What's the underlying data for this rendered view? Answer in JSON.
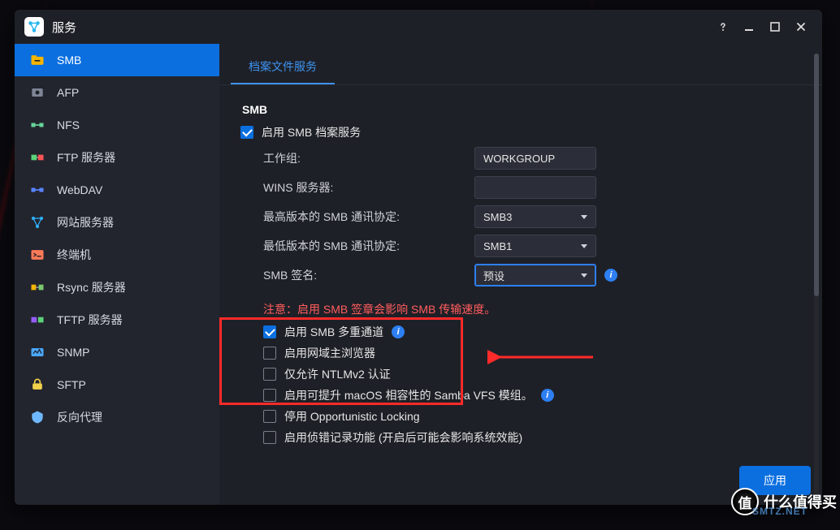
{
  "titlebar": {
    "title": "服务"
  },
  "sidebar": {
    "items": [
      {
        "id": "smb",
        "label": "SMB",
        "icon": "share-folder-icon",
        "color": "#f4b400"
      },
      {
        "id": "afp",
        "label": "AFP",
        "icon": "afp-icon",
        "color": "#7e8596"
      },
      {
        "id": "nfs",
        "label": "NFS",
        "icon": "nfs-icon",
        "color": "#66d59a"
      },
      {
        "id": "ftp",
        "label": "FTP 服务器",
        "icon": "ftp-icon",
        "color": "#5bd37a"
      },
      {
        "id": "webdav",
        "label": "WebDAV",
        "icon": "webdav-icon",
        "color": "#5884ff"
      },
      {
        "id": "website",
        "label": "网站服务器",
        "icon": "website-icon",
        "color": "#2fb0ff"
      },
      {
        "id": "terminal",
        "label": "终端机",
        "icon": "terminal-icon",
        "color": "#ff7a59"
      },
      {
        "id": "rsync",
        "label": "Rsync 服务器",
        "icon": "rsync-icon",
        "color": "#7bc96f"
      },
      {
        "id": "tftp",
        "label": "TFTP 服务器",
        "icon": "tftp-icon",
        "color": "#945eff"
      },
      {
        "id": "snmp",
        "label": "SNMP",
        "icon": "snmp-icon",
        "color": "#4aa8ff"
      },
      {
        "id": "sftp",
        "label": "SFTP",
        "icon": "sftp-icon",
        "color": "#f0d24b"
      },
      {
        "id": "proxy",
        "label": "反向代理",
        "icon": "proxy-icon",
        "color": "#6fb8ff"
      }
    ],
    "active": 0
  },
  "tabs": {
    "active": "档案文件服务"
  },
  "section": {
    "title": "SMB",
    "enable_label": "启用 SMB 档案服务",
    "enable_checked": true,
    "fields": {
      "workgroup_label": "工作组:",
      "workgroup_value": "WORKGROUP",
      "wins_label": "WINS 服务器:",
      "wins_value": "",
      "max_label": "最高版本的 SMB 通讯协定:",
      "max_value": "SMB3",
      "min_label": "最低版本的 SMB 通讯协定:",
      "min_value": "SMB1",
      "sign_label": "SMB 签名:",
      "sign_value": "预设"
    },
    "warning": "注意：启用 SMB 签章会影响 SMB 传输速度。",
    "opts": {
      "multi_channel": {
        "label": "启用 SMB 多重通道",
        "checked": true,
        "info": true
      },
      "master_browser": {
        "label": "启用网域主浏览器",
        "checked": false
      },
      "ntlmv2": {
        "label": "仅允许 NTLMv2 认证",
        "checked": false
      },
      "samba_vfs": {
        "label": "启用可提升 macOS 相容性的 Samba VFS 模组。",
        "checked": false,
        "info": true
      },
      "opp_locking": {
        "label": "停用 Opportunistic Locking",
        "checked": false
      },
      "debug_log": {
        "label": "启用侦错记录功能 (开启后可能会影响系统效能)",
        "checked": false
      }
    }
  },
  "footer": {
    "apply": "应用"
  },
  "watermark": {
    "text": "什么值得买",
    "badge": "值",
    "sub": "SMTZ.NET"
  }
}
